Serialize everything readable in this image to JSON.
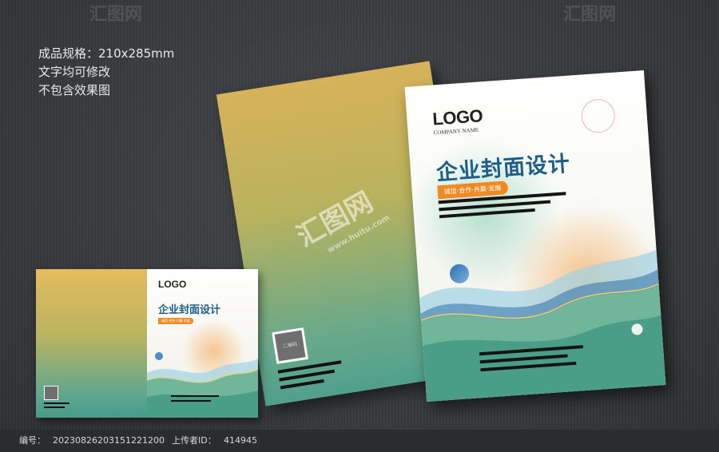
{
  "specs": {
    "line1": "成品规格：210x285mm",
    "line2": "文字均可修改",
    "line3": "不包含效果图"
  },
  "cover": {
    "logo": "LOGO",
    "logo_sub": "COMPANY NAME",
    "title": "企业封面设计",
    "tagline": "诚信·合作·共赢·发展",
    "qr_label": "二维码"
  },
  "watermark": {
    "mark": "汇图网",
    "url": "www.huitu.com"
  },
  "footer": {
    "id_label": "编号：",
    "id_value": "20230826203151221200",
    "uploader_label": "上传者ID：",
    "uploader_value": "414945"
  },
  "colors": {
    "title": "#1d5d86",
    "tag": "#f08a23",
    "gold": "#d7b25a",
    "teal": "#4fa08c"
  }
}
